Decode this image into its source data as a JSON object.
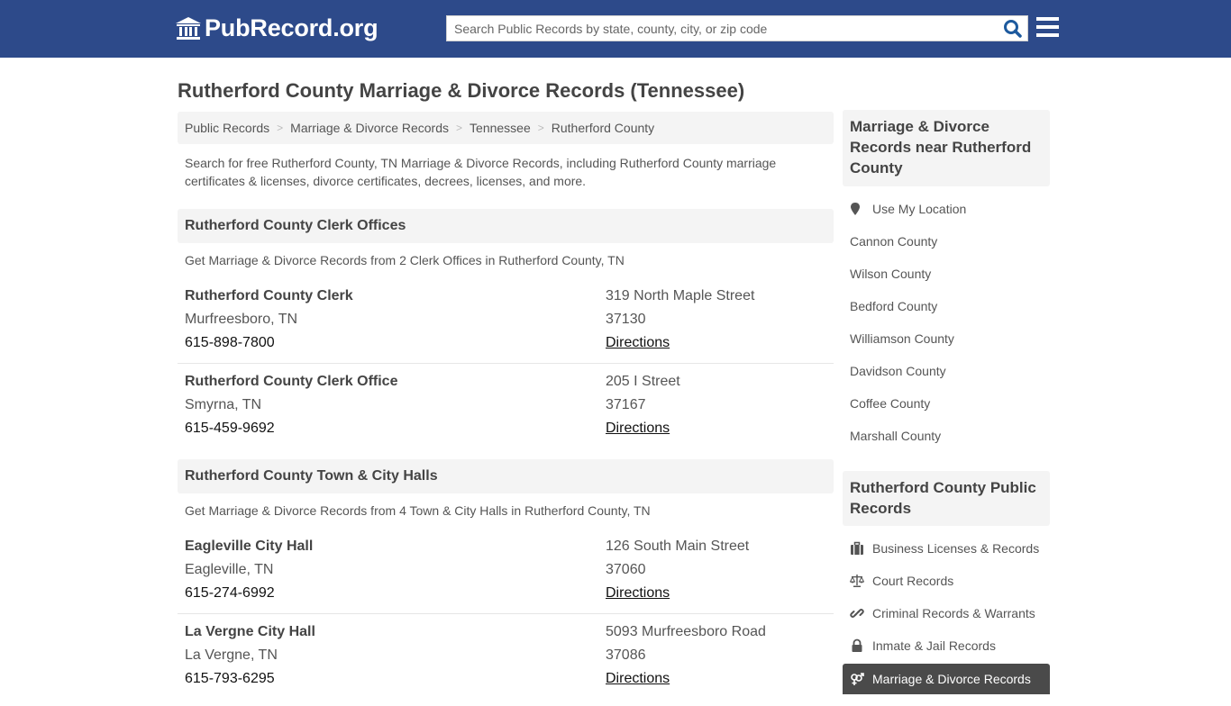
{
  "header": {
    "logo_text": "PubRecord.org",
    "search_placeholder": "Search Public Records by state, county, city, or zip code",
    "search_value": ""
  },
  "page_title": "Rutherford County Marriage & Divorce Records (Tennessee)",
  "breadcrumb": [
    "Public Records",
    "Marriage & Divorce Records",
    "Tennessee",
    "Rutherford County"
  ],
  "breadcrumb_separator": ">",
  "intro": "Search for free Rutherford County, TN Marriage & Divorce Records, including Rutherford County marriage certificates & licenses, divorce certificates, decrees, licenses, and more.",
  "sections": [
    {
      "title": "Rutherford County Clerk Offices",
      "subtitle": "Get Marriage & Divorce Records from 2 Clerk Offices in Rutherford County, TN",
      "entries": [
        {
          "name": "Rutherford County Clerk",
          "city": "Murfreesboro, TN",
          "phone": "615-898-7800",
          "address": "319 North Maple Street",
          "zip": "37130",
          "directions": "Directions"
        },
        {
          "name": "Rutherford County Clerk Office",
          "city": "Smyrna, TN",
          "phone": "615-459-9692",
          "address": "205 I Street",
          "zip": "37167",
          "directions": "Directions"
        }
      ]
    },
    {
      "title": "Rutherford County Town & City Halls",
      "subtitle": "Get Marriage & Divorce Records from 4 Town & City Halls in Rutherford County, TN",
      "entries": [
        {
          "name": "Eagleville City Hall",
          "city": "Eagleville, TN",
          "phone": "615-274-6992",
          "address": "126 South Main Street",
          "zip": "37060",
          "directions": "Directions"
        },
        {
          "name": "La Vergne City Hall",
          "city": "La Vergne, TN",
          "phone": "615-793-6295",
          "address": "5093 Murfreesboro Road",
          "zip": "37086",
          "directions": "Directions"
        }
      ]
    }
  ],
  "sidebar": {
    "nearby": {
      "title": "Marriage & Divorce Records near Rutherford County",
      "use_location": "Use My Location",
      "counties": [
        "Cannon County",
        "Wilson County",
        "Bedford County",
        "Williamson County",
        "Davidson County",
        "Coffee County",
        "Marshall County"
      ]
    },
    "public_records": {
      "title": "Rutherford County Public Records",
      "items": [
        {
          "label": "Business Licenses & Records",
          "icon": "briefcase-icon"
        },
        {
          "label": "Court Records",
          "icon": "balance-scale-icon"
        },
        {
          "label": "Criminal Records & Warrants",
          "icon": "link-icon"
        },
        {
          "label": "Inmate & Jail Records",
          "icon": "lock-icon"
        },
        {
          "label": "Marriage & Divorce Records",
          "icon": "venus-mars-icon",
          "active": true
        }
      ]
    }
  },
  "colors": {
    "header_bg": "#2d4a8a",
    "search_icon": "#1d5a9e",
    "panel_bg": "#f4f4f4",
    "active_item_bg": "#4a4a4a"
  }
}
